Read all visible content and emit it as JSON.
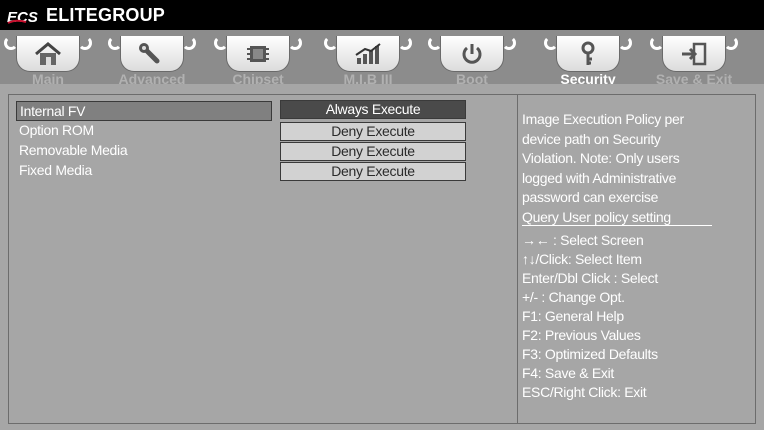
{
  "brand": {
    "name": "ELITEGROUP",
    "logo_text": "ECS"
  },
  "tabs": [
    {
      "label": "Main",
      "icon": "home-icon",
      "active": false
    },
    {
      "label": "Advanced",
      "icon": "wrench-icon",
      "active": false
    },
    {
      "label": "Chipset",
      "icon": "chip-icon",
      "active": false
    },
    {
      "label": "M.I.B III",
      "icon": "chart-icon",
      "active": false
    },
    {
      "label": "Boot",
      "icon": "power-icon",
      "active": false
    },
    {
      "label": "Security",
      "icon": "key-icon",
      "active": true
    },
    {
      "label": "Save & Exit",
      "icon": "exit-icon",
      "active": false
    }
  ],
  "options": [
    {
      "label": "Internal FV",
      "value": "Always Execute",
      "selected": true
    },
    {
      "label": "Option ROM",
      "value": "Deny Execute",
      "selected": false
    },
    {
      "label": "Removable Media",
      "value": "Deny Execute",
      "selected": false
    },
    {
      "label": "Fixed Media",
      "value": "Deny Execute",
      "selected": false
    }
  ],
  "help": {
    "lines": [
      "Image Execution Policy per",
      "device path on Security",
      "Violation. Note: Only users",
      "logged with Administrative",
      "password can exercise",
      "Query User policy setting"
    ]
  },
  "keys": [
    "→←  : Select Screen",
    "↑↓/Click: Select Item",
    "Enter/Dbl Click : Select",
    "+/- : Change Opt.",
    "F1: General Help",
    "F2: Previous Values",
    "F3: Optimized Defaults",
    "F4: Save & Exit",
    "ESC/Right Click: Exit"
  ],
  "colors": {
    "panel": "#a6a6a6",
    "tabstrip": "#8c8c8c",
    "selected_value_bg": "#4a4a4a",
    "value_bg": "#d2d2d2"
  }
}
